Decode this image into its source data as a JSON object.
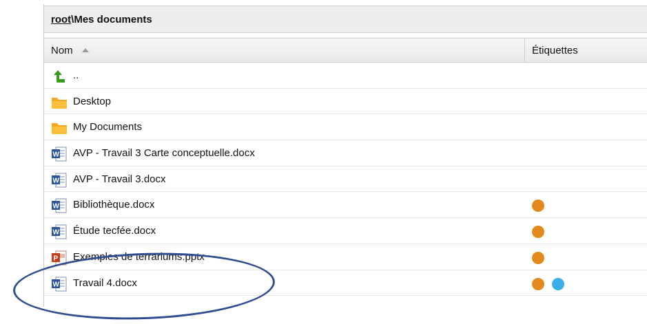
{
  "path": {
    "root": "root",
    "rest": "\\Mes documents"
  },
  "columns": {
    "name": "Nom",
    "tags": "Étiquettes"
  },
  "rows": [
    {
      "label": "..",
      "icon": "up-arrow-icon",
      "tags": []
    },
    {
      "label": "Desktop",
      "icon": "folder-icon",
      "tags": []
    },
    {
      "label": "My Documents",
      "icon": "folder-icon",
      "tags": []
    },
    {
      "label": "AVP - Travail 3 Carte conceptuelle.docx",
      "icon": "word-doc-icon",
      "tags": []
    },
    {
      "label": "AVP - Travail 3.docx",
      "icon": "word-doc-icon",
      "tags": []
    },
    {
      "label": "Bibliothèque.docx",
      "icon": "word-doc-icon",
      "tags": [
        "#e48a1c"
      ]
    },
    {
      "label": "Étude tecfée.docx",
      "icon": "word-doc-icon",
      "tags": [
        "#e48a1c"
      ]
    },
    {
      "label": "Exemples de terrariums.pptx",
      "icon": "powerpoint-icon",
      "tags": [
        "#e48a1c"
      ]
    },
    {
      "label": "Travail 4.docx",
      "icon": "word-doc-icon",
      "tags": [
        "#e48a1c",
        "#3aaee6"
      ]
    }
  ]
}
